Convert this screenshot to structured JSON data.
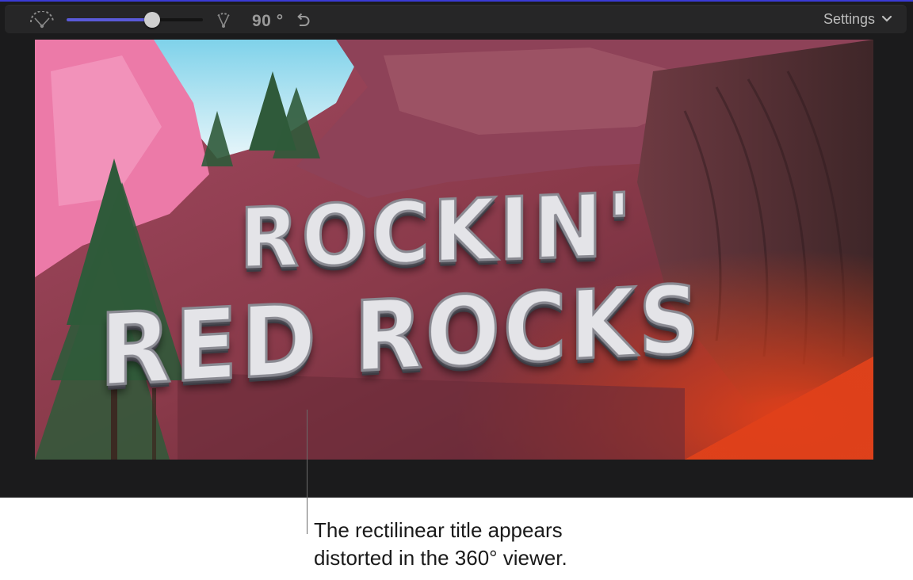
{
  "toolbar": {
    "fov_wide_icon": "field-of-view-wide-icon",
    "fov_slider_value_percent": 63,
    "fov_narrow_icon": "field-of-view-narrow-icon",
    "fov_value": "90 °",
    "reset_icon": "undo-arrow-icon",
    "settings_label": "Settings",
    "settings_chevron_icon": "chevron-down-icon",
    "accent_color": "#5a5ad8"
  },
  "viewer": {
    "title_line_1": "ROCKIN'",
    "title_line_2": "RED ROCKS"
  },
  "caption": {
    "line_1": "The rectilinear title appears",
    "line_2": "distorted in the 360° viewer."
  }
}
